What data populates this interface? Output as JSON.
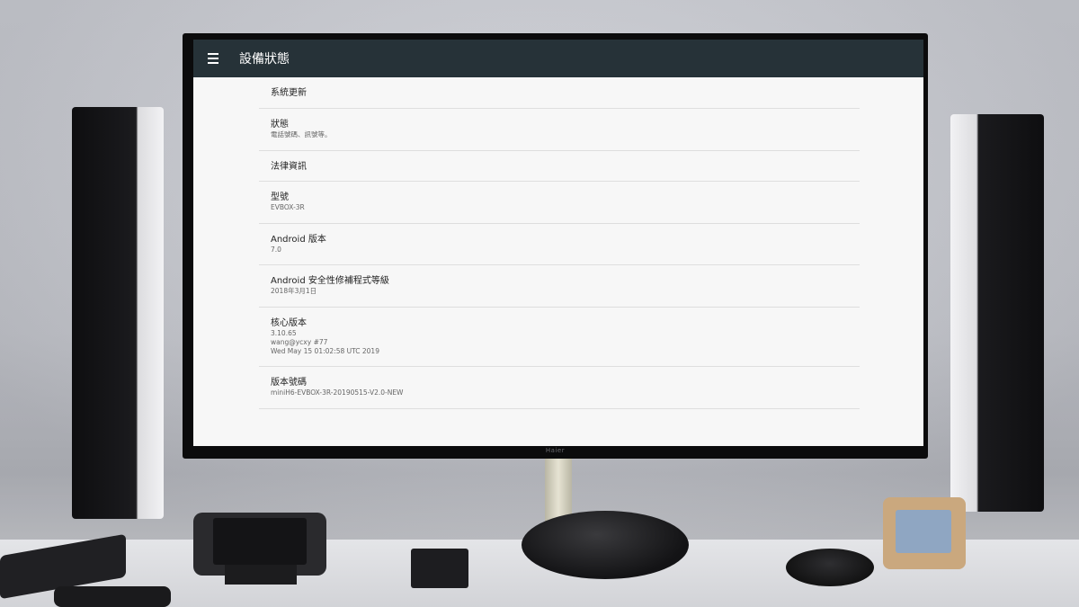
{
  "tv": {
    "brand": "Haier",
    "app_bar": {
      "title": "設備狀態",
      "menu_icon": "hamburger-menu-icon"
    },
    "items": [
      {
        "title": "系統更新",
        "subtitles": []
      },
      {
        "title": "狀態",
        "subtitles": [
          "電話號碼、訊號等。"
        ]
      },
      {
        "title": "法律資訊",
        "subtitles": []
      },
      {
        "title": "型號",
        "subtitles": [
          "EVBOX-3R"
        ]
      },
      {
        "title": "Android 版本",
        "subtitles": [
          "7.0"
        ]
      },
      {
        "title": "Android 安全性修補程式等級",
        "subtitles": [
          "2018年3月1日"
        ]
      },
      {
        "title": "核心版本",
        "subtitles": [
          "3.10.65",
          "wang@ycxy #77",
          "Wed May 15 01:02:58 UTC 2019"
        ]
      },
      {
        "title": "版本號碼",
        "subtitles": [
          "miniH6-EVBOX-3R-20190515-V2.0-NEW"
        ]
      }
    ]
  }
}
